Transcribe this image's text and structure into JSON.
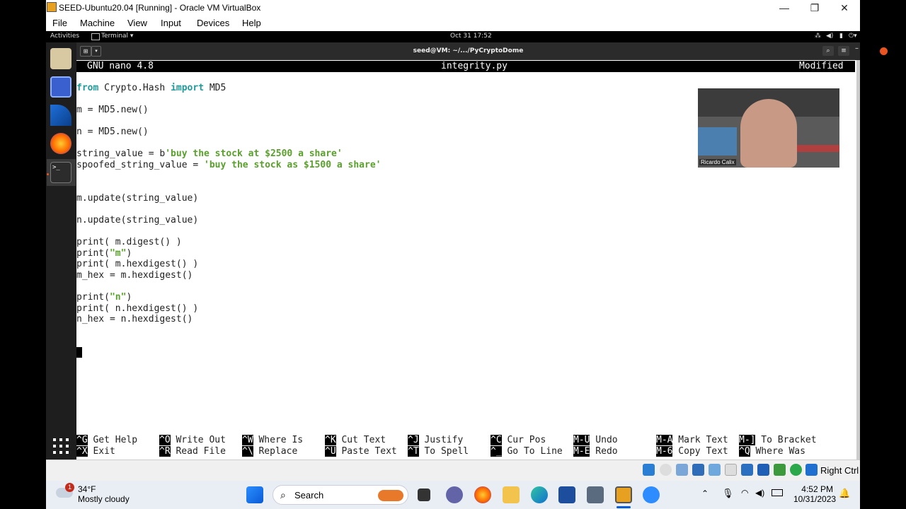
{
  "window": {
    "title": "SEED-Ubuntu20.04 [Running] - Oracle VM VirtualBox",
    "minimize": "—",
    "restore": "❐",
    "close": "✕"
  },
  "menu": [
    "File",
    "Machine",
    "View",
    "Input",
    "Devices",
    "Help"
  ],
  "gnome": {
    "activities": "Activities",
    "app": "Terminal ▾",
    "clock": "Oct 31  17:52"
  },
  "terminal": {
    "title": "seed@VM: ~/.../PyCryptoDome"
  },
  "nano": {
    "version": "GNU nano 4.8",
    "filename": "integrity.py",
    "status": "Modified"
  },
  "code": [
    [
      {
        "t": "from",
        "c": "kw"
      },
      {
        "t": " Crypto.Hash "
      },
      {
        "t": "import",
        "c": "kw"
      },
      {
        "t": " MD5"
      }
    ],
    [],
    [
      {
        "t": "m = MD5.new()"
      }
    ],
    [],
    [
      {
        "t": "n = MD5.new()"
      }
    ],
    [],
    [
      {
        "t": "string_value = b"
      },
      {
        "t": "'buy the stock at $2500 a share'",
        "c": "str"
      }
    ],
    [
      {
        "t": "spoofed_string_value = "
      },
      {
        "t": "'buy the stock as $1500 a share'",
        "c": "str"
      }
    ],
    [],
    [],
    [
      {
        "t": "m.update(string_value)"
      }
    ],
    [],
    [
      {
        "t": "n.update(string_value)"
      }
    ],
    [],
    [
      {
        "t": "print( m.digest() )"
      }
    ],
    [
      {
        "t": "print("
      },
      {
        "t": "\"m\"",
        "c": "str"
      },
      {
        "t": ")"
      }
    ],
    [
      {
        "t": "print( m.hexdigest() )"
      }
    ],
    [
      {
        "t": "m_hex = m.hexdigest()"
      }
    ],
    [],
    [
      {
        "t": "print("
      },
      {
        "t": "\"n\"",
        "c": "str"
      },
      {
        "t": ")"
      }
    ],
    [
      {
        "t": "print( n.hexdigest() )"
      }
    ],
    [
      {
        "t": "n_hex = n.hexdigest()"
      }
    ]
  ],
  "shortcuts": {
    "row1": [
      {
        "key": "^G",
        "label": "Get Help"
      },
      {
        "key": "^O",
        "label": "Write Out"
      },
      {
        "key": "^W",
        "label": "Where Is"
      },
      {
        "key": "^K",
        "label": "Cut Text"
      },
      {
        "key": "^J",
        "label": "Justify"
      },
      {
        "key": "^C",
        "label": "Cur Pos"
      },
      {
        "key": "M-U",
        "label": "Undo"
      },
      {
        "key": "M-A",
        "label": "Mark Text"
      },
      {
        "key": "M-]",
        "label": "To Bracket"
      }
    ],
    "row2": [
      {
        "key": "^X",
        "label": "Exit"
      },
      {
        "key": "^R",
        "label": "Read File"
      },
      {
        "key": "^\\",
        "label": "Replace"
      },
      {
        "key": "^U",
        "label": "Paste Text"
      },
      {
        "key": "^T",
        "label": "To Spell"
      },
      {
        "key": "^_",
        "label": "Go To Line"
      },
      {
        "key": "M-E",
        "label": "Redo"
      },
      {
        "key": "M-6",
        "label": "Copy Text"
      },
      {
        "key": "^Q",
        "label": "Where Was"
      }
    ]
  },
  "webcam": {
    "name": "Ricardo Calix"
  },
  "vbox_status": {
    "host_key": "Right Ctrl"
  },
  "taskbar": {
    "weather_temp": "34°F",
    "weather_desc": "Mostly cloudy",
    "weather_badge": "1",
    "search_label": "Search",
    "time": "4:52 PM",
    "date": "10/31/2023"
  },
  "colors": {
    "keyword": "#1f9a9a",
    "string": "#5aa02c",
    "dock_bg": "#1e1e1e",
    "taskbar_bg": "#e8eef4"
  }
}
